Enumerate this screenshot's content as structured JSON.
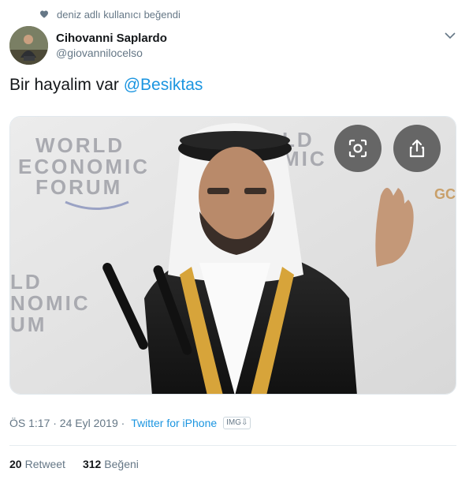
{
  "social_context": {
    "text": "deniz adlı kullanıcı beğendi",
    "icon": "heart-icon"
  },
  "author": {
    "display_name": "Cihovanni Saplardo",
    "username": "@giovannilocelso"
  },
  "tweet": {
    "text_prefix": "Bir hayalim var ",
    "mention": "@Besiktas"
  },
  "media": {
    "image_text_left": [
      "WORLD",
      "ECONOMIC",
      "FORUM"
    ],
    "image_text_left_lower": [
      "LD",
      "NOMIC",
      "UM"
    ],
    "image_text_right": [
      "LD",
      "MIC"
    ],
    "image_text_far_right": "GC",
    "buttons": [
      "lens-icon",
      "share-icon"
    ]
  },
  "meta": {
    "timestamp": "ÖS 1:17 · 24 Eyl 2019 · ",
    "source": "Twitter for iPhone",
    "badge": "IMG⇩"
  },
  "stats": {
    "retweets": "20",
    "retweets_label": "Retweet",
    "likes": "312",
    "likes_label": "Beğeni"
  },
  "colors": {
    "link": "#1b95e0",
    "secondary": "#657786",
    "primary": "#14171a"
  }
}
